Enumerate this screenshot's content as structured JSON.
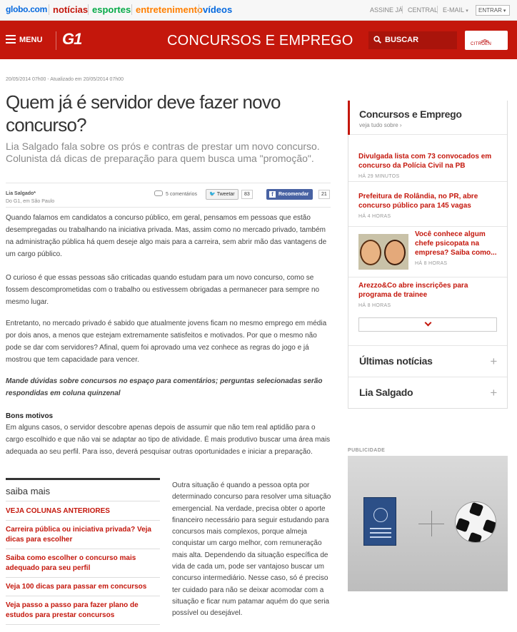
{
  "topbar": {
    "logo": "globo.com",
    "nav": [
      {
        "label": "notícias",
        "color": "#c4170c"
      },
      {
        "label": "esportes",
        "color": "#06aa48"
      },
      {
        "label": "entretenimento",
        "color": "#ff7f00"
      },
      {
        "label": "vídeos",
        "color": "#0669de"
      }
    ],
    "right": [
      "ASSINE JÁ",
      "CENTRAL",
      "E-MAIL"
    ],
    "entrar": "ENTRAR"
  },
  "header": {
    "menu": "MENU",
    "brand": "G1",
    "section": "CONCURSOS E EMPREGO",
    "search": "BUSCAR",
    "sponsor": "CITROËN"
  },
  "article": {
    "date": "20/05/2014 07h00 - Atualizado em 20/05/2014 07h00",
    "title": "Quem já é servidor deve fazer novo concurso?",
    "subtitle": "Lia Salgado fala sobre os prós e contras de prestar um novo concurso. Colunista dá dicas de preparação para quem busca uma \"promoção\".",
    "author": "Lia Salgado*",
    "author_place": "Do G1, em São Paulo",
    "comments": "5 comentários",
    "tweet": "Tweetar",
    "tweet_count": "83",
    "fb": "Recomendar",
    "fb_count": "21",
    "p1": "Quando falamos em candidatos a concurso público, em geral, pensamos em pessoas que estão desempregadas ou trabalhando na iniciativa privada. Mas, assim como no mercado privado, também na administração pública há quem deseje algo mais para a carreira, sem abrir mão das vantagens de um cargo público.",
    "p2": "O curioso é que essas pessoas são criticadas quando estudam para um novo concurso, como se fossem descomprometidas com o trabalho ou estivessem obrigadas a permanecer para sempre no mesmo lugar.",
    "p3": "Entretanto, no mercado privado é sabido que atualmente jovens ficam no mesmo emprego em média por dois anos, a menos que estejam extremamente satisfeitos e motivados. Por que o mesmo não pode se dar com servidores? Afinal, quem foi aprovado uma vez conhece as regras do jogo e já mostrou que tem capacidade para vencer.",
    "p4": "Mande dúvidas sobre concursos no espaço para comentários; perguntas selecionadas serão respondidas em coluna quinzenal",
    "h1": "Bons motivos",
    "p5": "Em alguns casos, o servidor descobre apenas depois de assumir que não tem real aptidão para o cargo escolhido e que não vai se adaptar ao tipo de atividade. É mais produtivo buscar uma área mais adequada ao seu perfil. Para isso, deverá pesquisar outras oportunidades e iniciar a preparação.",
    "p6": "Outra situação é quando a pessoa opta por determinado concurso para resolver uma situação emergencial. Na verdade, precisa obter o aporte financeiro necessário para seguir estudando para concursos mais complexos, porque almeja conquistar um cargo melhor, com remuneração mais alta. Dependendo da situação específica de vida de cada um, pode ser vantajoso buscar um concurso intermediário. Nesse caso, só é preciso ter cuidado para não se deixar acomodar com a situação e ficar num patamar aquém do que seria possível ou desejável."
  },
  "saiba": {
    "head": "saiba mais",
    "items": [
      "VEJA COLUNAS ANTERIORES",
      "Carreira pública ou iniciativa privada? Veja dicas para escolher",
      "Saiba como escolher o concurso mais adequado para seu perfil",
      "Veja 100 dicas para passar em concursos",
      "Veja passo a passo para fazer plano de estudos para prestar concursos"
    ]
  },
  "sidebar": {
    "title": "Concursos e Emprego",
    "sub": "veja tudo sobre ›",
    "news": [
      {
        "title": "Divulgada lista com 73 convocados em concurso da Polícia Civil na PB",
        "time": "HÁ 29 MINUTOS"
      },
      {
        "title": "Prefeitura de Rolândia, no PR, abre concurso público para 145 vagas",
        "time": "HÁ 4 HORAS"
      },
      {
        "title": "Você conhece algum chefe psicopata na empresa? Saiba como...",
        "time": "HÁ 8 HORAS"
      },
      {
        "title": "Arezzo&Co abre inscrições para programa de trainee",
        "time": "HÁ 8 HORAS"
      }
    ],
    "collapsibles": [
      "Últimas notícias",
      "Lia Salgado"
    ]
  },
  "ad": {
    "label": "PUBLICIDADE"
  }
}
